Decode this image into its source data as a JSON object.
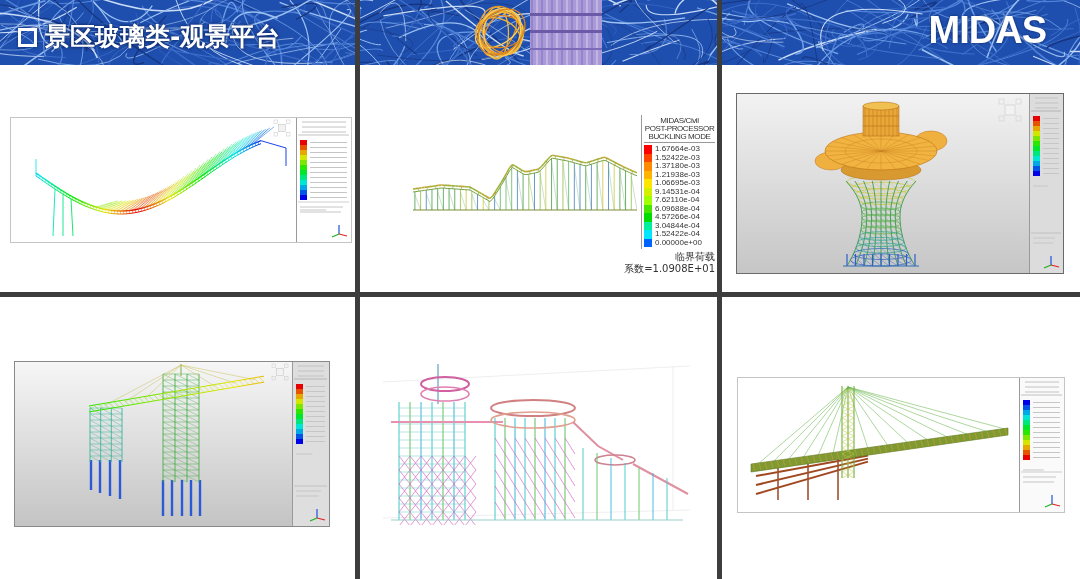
{
  "header": {
    "title": "景区玻璃类-观景平台",
    "logo": "MIDAS"
  },
  "panels": [
    {
      "kind": "wave-bridge"
    },
    {
      "kind": "track-frame",
      "legend": {
        "title_lines": [
          "MIDAS/Civil",
          "POST-PROCESSOR",
          "BUCKLING MODE"
        ],
        "entries": [
          {
            "value": "1.67664e-03",
            "color": "#ff0000"
          },
          {
            "value": "1.52422e-03",
            "color": "#ff4600"
          },
          {
            "value": "1.37180e-03",
            "color": "#ff8c00"
          },
          {
            "value": "1.21938e-03",
            "color": "#ffb400"
          },
          {
            "value": "1.06695e-03",
            "color": "#ffe600"
          },
          {
            "value": "9.14531e-04",
            "color": "#d2f000"
          },
          {
            "value": "7.62110e-04",
            "color": "#a0ff00"
          },
          {
            "value": "6.09688e-04",
            "color": "#46e600"
          },
          {
            "value": "4.57266e-04",
            "color": "#00dc00"
          },
          {
            "value": "3.04844e-04",
            "color": "#00f0a0"
          },
          {
            "value": "1.52422e-04",
            "color": "#00e6ff"
          },
          {
            "value": "0.00000e+00",
            "color": "#0064ff"
          }
        ],
        "footer": [
          "临界荷载",
          "系数=1.0908E+01"
        ]
      }
    },
    {
      "kind": "tower-platform"
    },
    {
      "kind": "crane-tower"
    },
    {
      "kind": "spiral-tower"
    },
    {
      "kind": "cable-bridge"
    }
  ]
}
